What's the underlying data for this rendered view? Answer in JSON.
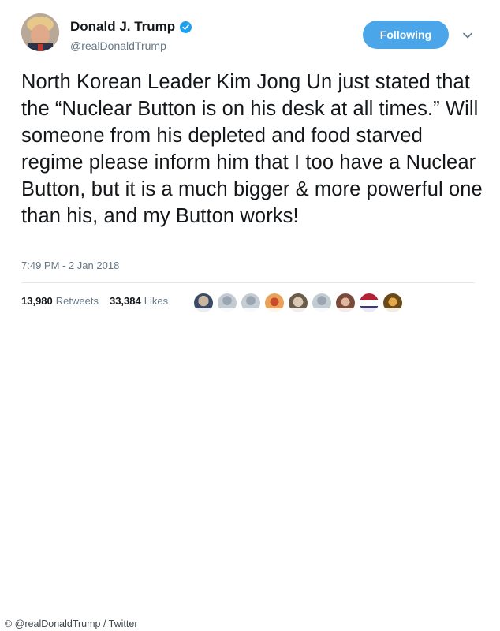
{
  "user": {
    "name": "Donald J. Trump",
    "handle": "@realDonaldTrump"
  },
  "follow_button": {
    "label": "Following"
  },
  "tweet": {
    "text": "North Korean Leader Kim Jong Un just stated that the “Nuclear Button is on his desk at all times.” Will someone from his depleted and food starved regime please inform him that I too have a Nuclear Button, but it is a much bigger & more powerful one than his, and my Button works!",
    "timestamp": "7:49 PM - 2 Jan 2018"
  },
  "stats": {
    "retweets_count": "13,980",
    "retweets_label": "Retweets",
    "likes_count": "33,384",
    "likes_label": "Likes"
  },
  "image_credit": "© @realDonaldTrump / Twitter",
  "colors": {
    "button": "#4aa6e8",
    "verified": "#1da1f2",
    "secondary_text": "#657786"
  }
}
